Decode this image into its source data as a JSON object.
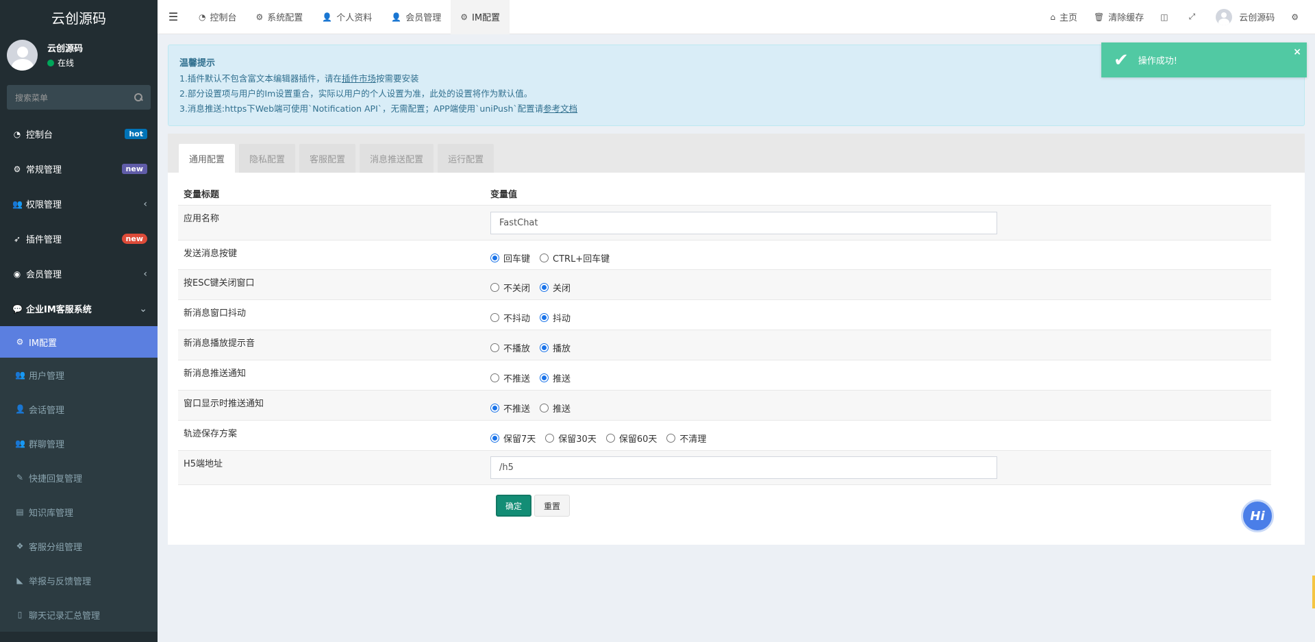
{
  "sidebar": {
    "logo": "云创源码",
    "user": {
      "name": "云创源码",
      "status": "在线"
    },
    "search_placeholder": "搜索菜单",
    "items": [
      {
        "label": "控制台",
        "badge": "hot"
      },
      {
        "label": "常规管理",
        "badge": "new"
      },
      {
        "label": "权限管理",
        "chevron": "‹"
      },
      {
        "label": "插件管理",
        "badge": "new"
      },
      {
        "label": "会员管理",
        "chevron": "‹"
      },
      {
        "label": "企业IM客服系统",
        "chevron": "⌄"
      }
    ],
    "subitems": [
      {
        "label": "IM配置"
      },
      {
        "label": "用户管理"
      },
      {
        "label": "会话管理"
      },
      {
        "label": "群聊管理"
      },
      {
        "label": "快捷回复管理"
      },
      {
        "label": "知识库管理"
      },
      {
        "label": "客服分组管理"
      },
      {
        "label": "举报与反馈管理"
      },
      {
        "label": "聊天记录汇总管理"
      }
    ]
  },
  "topbar": {
    "tabs": [
      "控制台",
      "系统配置",
      "个人资料",
      "会员管理",
      "IM配置"
    ],
    "right": {
      "home": "主页",
      "clear_cache": "清除缓存",
      "user": "云创源码"
    }
  },
  "alert": {
    "title": "温馨提示",
    "line1_pre": "1.插件默认不包含富文本编辑器插件，请在",
    "line1_link": "插件市场",
    "line1_post": "按需要安装",
    "line2": "2.部分设置项与用户的Im设置重合，实际以用户的个人设置为准，此处的设置将作为默认值。",
    "line3_pre": "3.消息推送:https下Web端可使用`Notification API`，无需配置；APP端使用`uniPush`配置请",
    "line3_link": "参考文档"
  },
  "toast": {
    "message": "操作成功!",
    "close": "×"
  },
  "panel": {
    "tabs": [
      "通用配置",
      "隐私配置",
      "客服配置",
      "消息推送配置",
      "运行配置"
    ],
    "header": {
      "col1": "变量标题",
      "col2": "变量值"
    },
    "rows": {
      "app_name": {
        "label": "应用名称",
        "value": "FastChat"
      },
      "send_key": {
        "label": "发送消息按键",
        "opt1": "回车键",
        "opt2": "CTRL+回车键"
      },
      "esc_close": {
        "label": "按ESC键关闭窗口",
        "opt1": "不关闭",
        "opt2": "关闭"
      },
      "shake": {
        "label": "新消息窗口抖动",
        "opt1": "不抖动",
        "opt2": "抖动"
      },
      "sound": {
        "label": "新消息播放提示音",
        "opt1": "不播放",
        "opt2": "播放"
      },
      "push": {
        "label": "新消息推送通知",
        "opt1": "不推送",
        "opt2": "推送"
      },
      "window_push": {
        "label": "窗口显示时推送通知",
        "opt1": "不推送",
        "opt2": "推送"
      },
      "trace": {
        "label": "轨迹保存方案",
        "opt1": "保留7天",
        "opt2": "保留30天",
        "opt3": "保留60天",
        "opt4": "不清理"
      },
      "h5": {
        "label": "H5端地址",
        "value": "/h5"
      }
    },
    "buttons": {
      "ok": "确定",
      "reset": "重置"
    }
  },
  "chat_bubble": "Hi",
  "colors": {
    "sidebar_bg": "#222d32",
    "active_menu": "#5b7fe0",
    "toast_bg": "#51c9a3",
    "alert_bg": "#d9edf7"
  }
}
